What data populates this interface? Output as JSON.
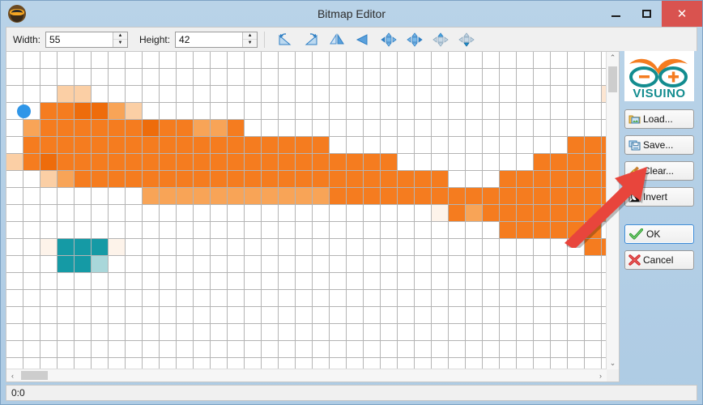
{
  "window": {
    "title": "Bitmap Editor",
    "app_icon": "owl-app-icon",
    "minimize_label": "–",
    "maximize_label": "□",
    "close_label": "✕"
  },
  "toolbar": {
    "width_label": "Width:",
    "width_value": "55",
    "height_label": "Height:",
    "height_value": "42",
    "spin_up": "▲",
    "spin_down": "▼",
    "icons": [
      {
        "name": "rotate-left-icon",
        "title": "Rotate Left"
      },
      {
        "name": "rotate-right-icon",
        "title": "Rotate Right"
      },
      {
        "name": "flip-horizontal-icon",
        "title": "Flip Horizontal"
      },
      {
        "name": "flip-vertical-icon",
        "title": "Flip Vertical"
      },
      {
        "name": "shift-left-icon",
        "title": "Shift Left"
      },
      {
        "name": "shift-right-icon",
        "title": "Shift Right"
      },
      {
        "name": "shift-up-icon",
        "title": "Shift Up"
      },
      {
        "name": "shift-down-icon",
        "title": "Shift Down"
      }
    ]
  },
  "panel": {
    "logo_text": "VISUINO",
    "logo_minus": "–",
    "logo_plus": "+",
    "buttons": [
      {
        "name": "load-button",
        "label": "Load...",
        "icon": "folder-open-icon"
      },
      {
        "name": "save-button",
        "label": "Save...",
        "icon": "floppy-disk-icon"
      },
      {
        "name": "clear-button",
        "label": "Clear...",
        "icon": "broom-icon"
      },
      {
        "name": "invert-button",
        "label": "Invert",
        "icon": "invert-colors-icon"
      },
      {
        "name": "ok-button",
        "label": "OK",
        "icon": "green-check-icon",
        "primary": true
      },
      {
        "name": "cancel-button",
        "label": "Cancel",
        "icon": "red-x-icon"
      }
    ]
  },
  "statusbar": {
    "coordinates": "0:0"
  },
  "scrollbars": {
    "up_arrow": "⌃",
    "down_arrow": "⌄",
    "left_arrow": "‹",
    "right_arrow": "›"
  },
  "canvas": {
    "cell_size": 21,
    "cols": 36,
    "rows": 19,
    "grid_line_color": "#b4b4b4",
    "background": "#ffffff",
    "cursor_cell": [
      0,
      0
    ],
    "cursor_color": "#2f96e8",
    "palette": {
      "orange": "#f57c1f",
      "orange_deep": "#ee6c0b",
      "orange_light": "#f8a457",
      "peach": "#fbcfa5",
      "peach_pale": "#fde6d2",
      "cream": "#fdf3ea",
      "teal": "#159aa5",
      "teal_dark": "#0e7f88",
      "teal_mid": "#3fb0b5",
      "teal_light": "#a9d7da",
      "teal_pale": "#dbeef0",
      "red": "#dc3c06",
      "red_light": "#e98b55",
      "red_pale": "#fae0d6",
      "white": "#ffffff"
    },
    "pixels": [
      "............................................",
      "...cc..............................e........",
      "..1122bc....................................",
      ".b111111211bb1......................1b.b1...",
      ".111111111111111111..............11111111...",
      "c1211111111111111111111........11111111111..",
      "..cb1111111111111111111111...1111111111b1...",
      "........bbbbbbbbbbb1111111111111111111111...",
      ".........................p1b1111111bc1.1....",
      ".............................111111..11.....",
      "..pTTTp...........................11...1....",
      "...TTL..............................c......."
    ]
  },
  "annotation": {
    "arrow": "red-arrow-pointing-to-load-button",
    "color": "#e8453c"
  }
}
